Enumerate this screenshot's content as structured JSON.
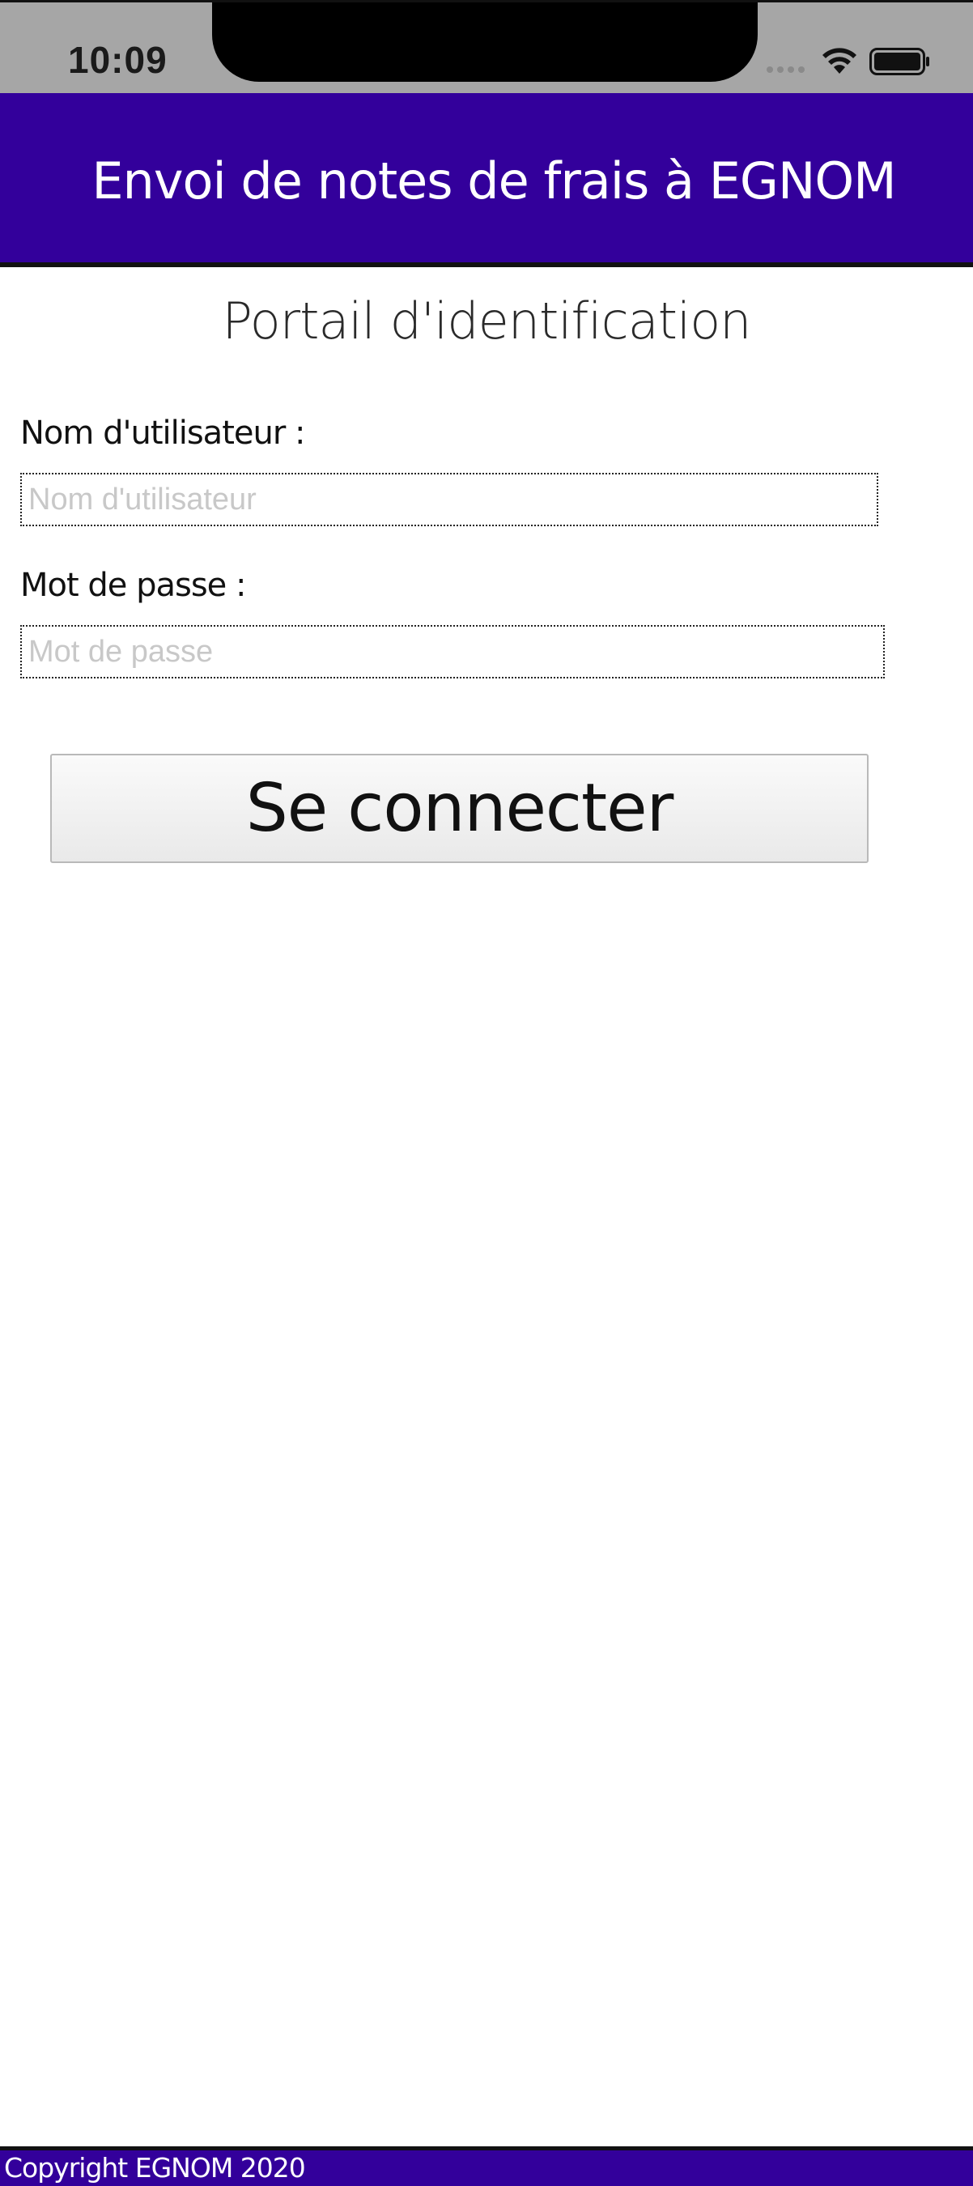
{
  "status_bar": {
    "time": "10:09",
    "icons": [
      "signal-icon",
      "wifi-icon",
      "battery-icon"
    ]
  },
  "header": {
    "title": "Envoi de notes de frais à EGNOM",
    "background_color": "#33009b"
  },
  "login": {
    "portal_title": "Portail d'identification",
    "username_label": "Nom d'utilisateur :",
    "username_placeholder": "Nom d'utilisateur",
    "username_value": "",
    "password_label": "Mot de passe :",
    "password_placeholder": "Mot de passe",
    "password_value": "",
    "submit_label": "Se connecter"
  },
  "footer": {
    "copyright": "Copyright EGNOM 2020",
    "background_color": "#33009b"
  }
}
